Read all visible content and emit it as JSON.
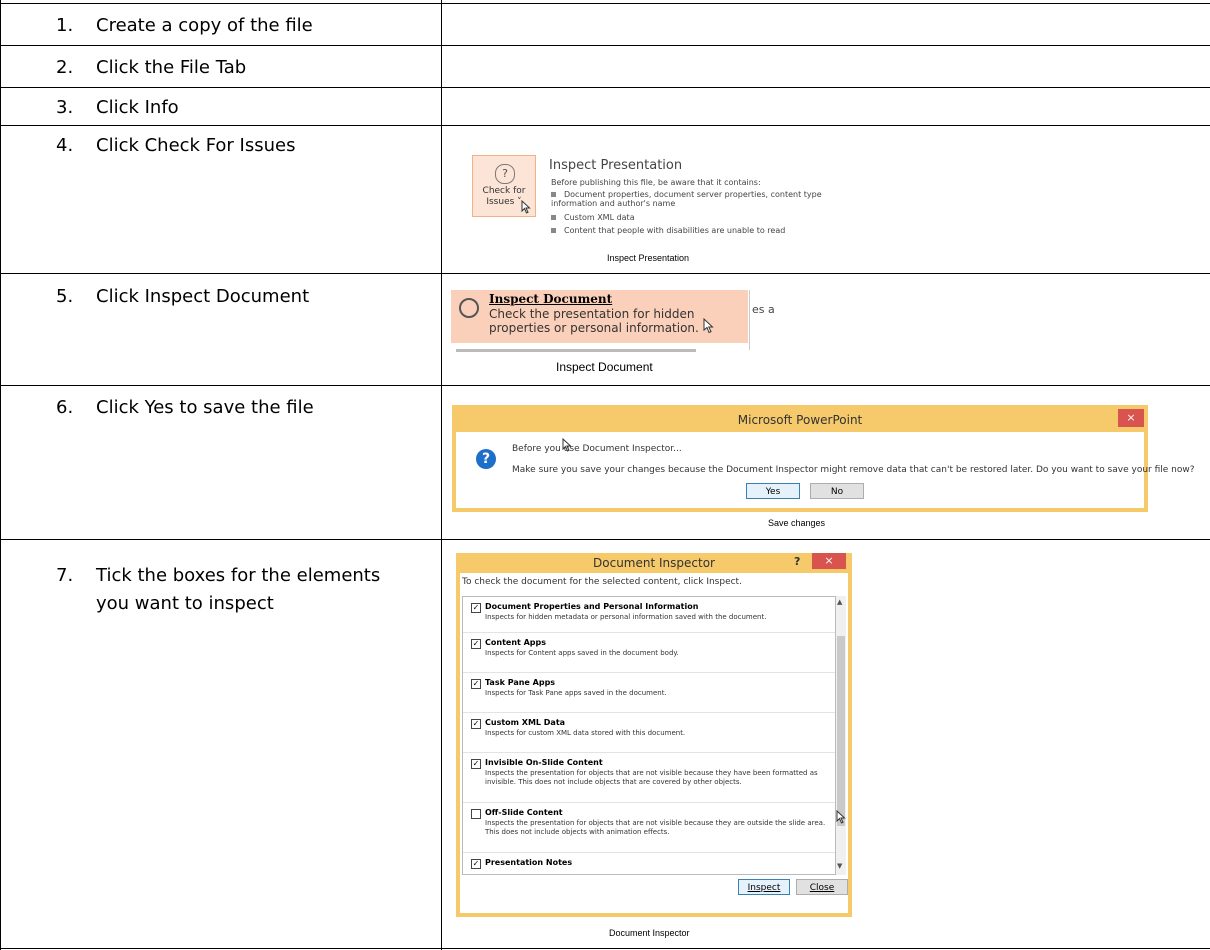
{
  "steps": [
    {
      "num": "1.",
      "text": "Create a copy of the file"
    },
    {
      "num": "2.",
      "text": "Click the File Tab"
    },
    {
      "num": "3.",
      "text": "Click Info"
    },
    {
      "num": "4.",
      "text": "Click Check For Issues"
    },
    {
      "num": "5.",
      "text": "Click Inspect Document"
    },
    {
      "num": "6.",
      "text": "Click Yes to save the file"
    },
    {
      "num": "7.",
      "text": "Tick the boxes for the elements you want to inspect"
    }
  ],
  "step4": {
    "button_label": "Check for Issues ˅",
    "title": "Inspect Presentation",
    "intro": "Before publishing this file, be aware that it contains:",
    "bullets": [
      "Document properties, document server properties, content type information and author's name",
      "Custom XML data",
      "Content that people with disabilities are unable to read"
    ],
    "caption": "Inspect Presentation"
  },
  "step5": {
    "title": "Inspect Document",
    "desc": "Check the presentation for hidden properties or personal information.",
    "side_fragment": "es a",
    "caption": "Inspect Document"
  },
  "step6": {
    "title": "Microsoft PowerPoint",
    "close": "×",
    "line1": "Before you use Document Inspector...",
    "line2": "Make sure you save your changes because the Document Inspector might remove data that can't be restored later. Do you want to save your file now?",
    "yes": "Yes",
    "no": "No",
    "caption": "Save changes"
  },
  "step7": {
    "title": "Document Inspector",
    "help": "?",
    "close": "×",
    "instruction": "To check the document for the selected content, click Inspect.",
    "items": [
      {
        "title": "Document Properties and Personal Information",
        "desc": "Inspects for hidden metadata or personal information saved with the document.",
        "checked": true
      },
      {
        "title": "Content Apps",
        "desc": "Inspects for Content apps saved in the document body.",
        "checked": true
      },
      {
        "title": "Task Pane Apps",
        "desc": "Inspects for Task Pane apps saved in the document.",
        "checked": true
      },
      {
        "title": "Custom XML Data",
        "desc": "Inspects for custom XML data stored with this document.",
        "checked": true
      },
      {
        "title": "Invisible On-Slide Content",
        "desc": "Inspects the presentation for objects that are not visible because they have been formatted as invisible. This does not include objects that are covered by other objects.",
        "checked": true
      },
      {
        "title": "Off-Slide Content",
        "desc": "Inspects the presentation for objects that are not visible because they are outside the slide area. This does not include objects with animation effects.",
        "checked": false
      },
      {
        "title": "Presentation Notes",
        "desc": "",
        "checked": true
      }
    ],
    "inspect": "Inspect",
    "close_btn": "Close",
    "caption": "Document Inspector"
  }
}
